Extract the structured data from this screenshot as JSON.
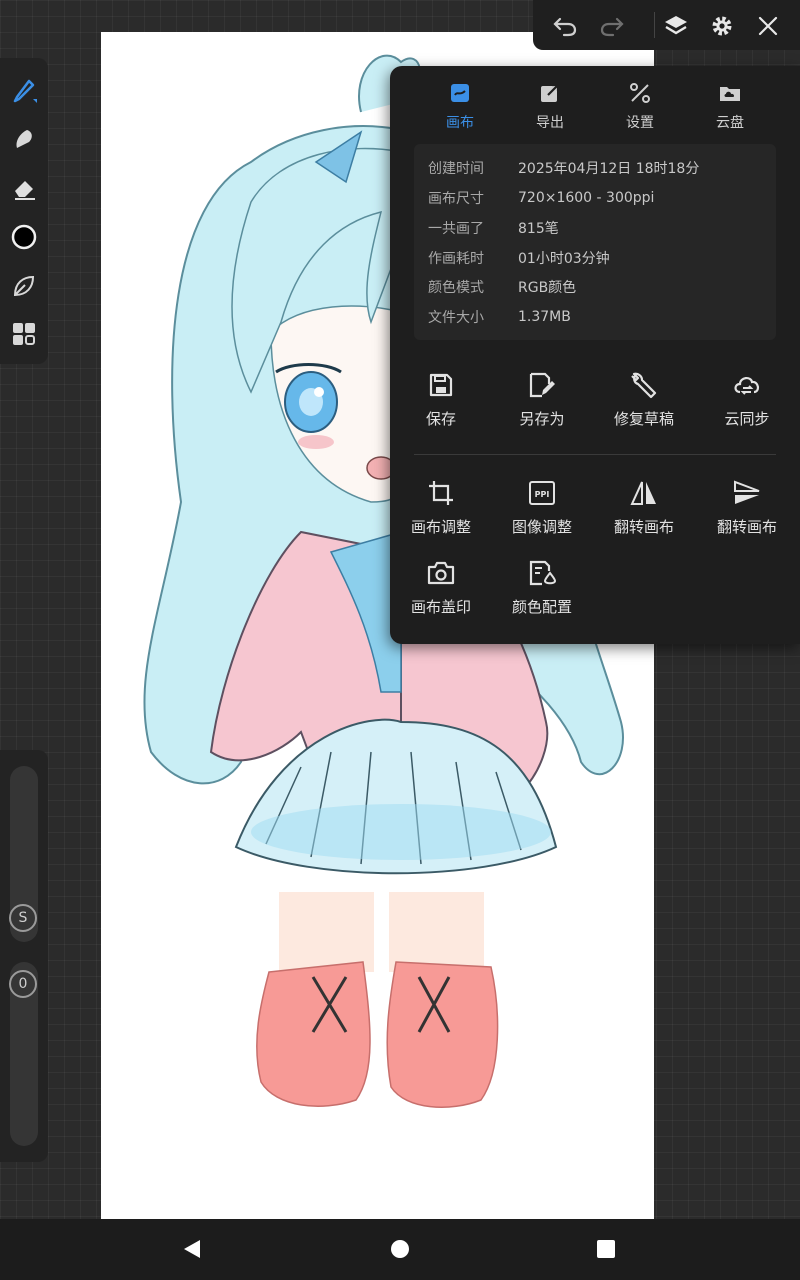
{
  "toolbar_left": {
    "tools": [
      "brush-icon",
      "smudge-icon",
      "eraser-icon",
      "color-icon",
      "leaf-icon",
      "grid-icon"
    ],
    "size_slider_label": "S",
    "opacity_slider_label": "0"
  },
  "top_bar": {
    "buttons": [
      "undo-icon",
      "redo-icon",
      "layers-icon",
      "gear-icon",
      "close-icon"
    ]
  },
  "panel": {
    "tabs": [
      {
        "label": "画布",
        "icon": "canvas-icon",
        "active": true
      },
      {
        "label": "导出",
        "icon": "export-icon",
        "active": false
      },
      {
        "label": "设置",
        "icon": "settings-icon",
        "active": false
      },
      {
        "label": "云盘",
        "icon": "cloud-drive-icon",
        "active": false
      }
    ],
    "info": [
      {
        "key": "创建时间",
        "value": "2025年04月12日 18时18分"
      },
      {
        "key": "画布尺寸",
        "value": "720×1600 - 300ppi"
      },
      {
        "key": "一共画了",
        "value": "815笔"
      },
      {
        "key": "作画耗时",
        "value": "01小时03分钟"
      },
      {
        "key": "颜色模式",
        "value": "RGB颜色"
      },
      {
        "key": "文件大小",
        "value": "1.37MB"
      }
    ],
    "actions_row1": [
      {
        "label": "保存",
        "icon": "save-icon"
      },
      {
        "label": "另存为",
        "icon": "save-as-icon"
      },
      {
        "label": "修复草稿",
        "icon": "wrench-icon"
      },
      {
        "label": "云同步",
        "icon": "cloud-sync-icon"
      }
    ],
    "actions_row2": [
      {
        "label": "画布调整",
        "icon": "crop-icon"
      },
      {
        "label": "图像调整",
        "icon": "ppi-icon",
        "icon_text": "PPI"
      },
      {
        "label": "翻转画布",
        "icon": "flip-horizontal-icon"
      },
      {
        "label": "翻转画布",
        "icon": "flip-vertical-icon"
      }
    ],
    "actions_row3": [
      {
        "label": "画布盖印",
        "icon": "camera-icon"
      },
      {
        "label": "颜色配置",
        "icon": "color-profile-icon"
      }
    ]
  },
  "accent_color": "#3b8fe6",
  "nav_bar": {
    "buttons": [
      "back-icon",
      "home-icon",
      "recents-icon"
    ]
  }
}
